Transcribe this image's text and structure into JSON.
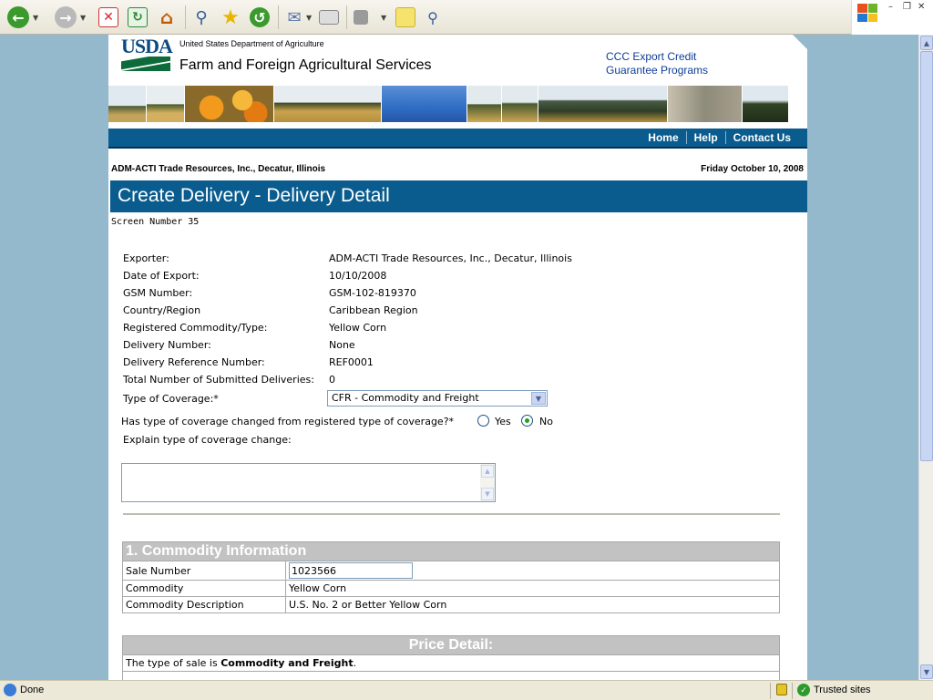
{
  "browser": {
    "status_text": "Done",
    "zone_text": "Trusted sites"
  },
  "header": {
    "logo_text": "USDA",
    "agency_small": "United States Department of Agriculture",
    "agency_big": "Farm and Foreign Agricultural Services",
    "program_line1": "CCC Export Credit",
    "program_line2": "Guarantee Programs"
  },
  "nav": {
    "home": "Home",
    "help": "Help",
    "contact": "Contact Us"
  },
  "context": {
    "exporter_line": "ADM-ACTI Trade Resources, Inc., Decatur, Illinois",
    "date_line": "Friday October 10, 2008"
  },
  "page": {
    "title": "Create Delivery - Delivery Detail",
    "screen_number": "Screen Number 35"
  },
  "fields": {
    "exporter_label": "Exporter:",
    "exporter_value": "ADM-ACTI Trade Resources, Inc., Decatur, Illinois",
    "date_label": "Date of Export:",
    "date_value": "10/10/2008",
    "gsm_label": "GSM Number:",
    "gsm_value": "GSM-102-819370",
    "country_label": "Country/Region",
    "country_value": "Caribbean Region",
    "commodity_label": "Registered Commodity/Type:",
    "commodity_value": "Yellow Corn",
    "delivery_label": "Delivery Number:",
    "delivery_value": "None",
    "ref_label": "Delivery Reference Number:",
    "ref_value": "REF0001",
    "total_label": "Total Number of Submitted Deliveries:",
    "total_value": "0",
    "coverage_label": "Type of Coverage:*",
    "coverage_value": "CFR - Commodity and Freight",
    "changed_question": "Has type of coverage changed from registered type of coverage?*",
    "yes_label": "Yes",
    "no_label": "No",
    "changed_selected": "No",
    "explain_label": "Explain type of coverage change:"
  },
  "commodity_section": {
    "heading": "1. Commodity Information",
    "rows": [
      {
        "label": "Sale Number",
        "value": "1023566"
      },
      {
        "label": "Commodity",
        "value": "Yellow Corn"
      },
      {
        "label": "Commodity Description",
        "value": "U.S. No. 2 or Better Yellow Corn"
      }
    ]
  },
  "price_section": {
    "heading": "Price Detail:",
    "sale_type_prefix": "The type of sale is ",
    "sale_type_value": "Commodity and Freight",
    "sale_type_suffix": "."
  },
  "colors": {
    "nav_blue": "#0a5c8e",
    "section_gray": "#c2c2c2",
    "radio_green": "#21a121"
  }
}
